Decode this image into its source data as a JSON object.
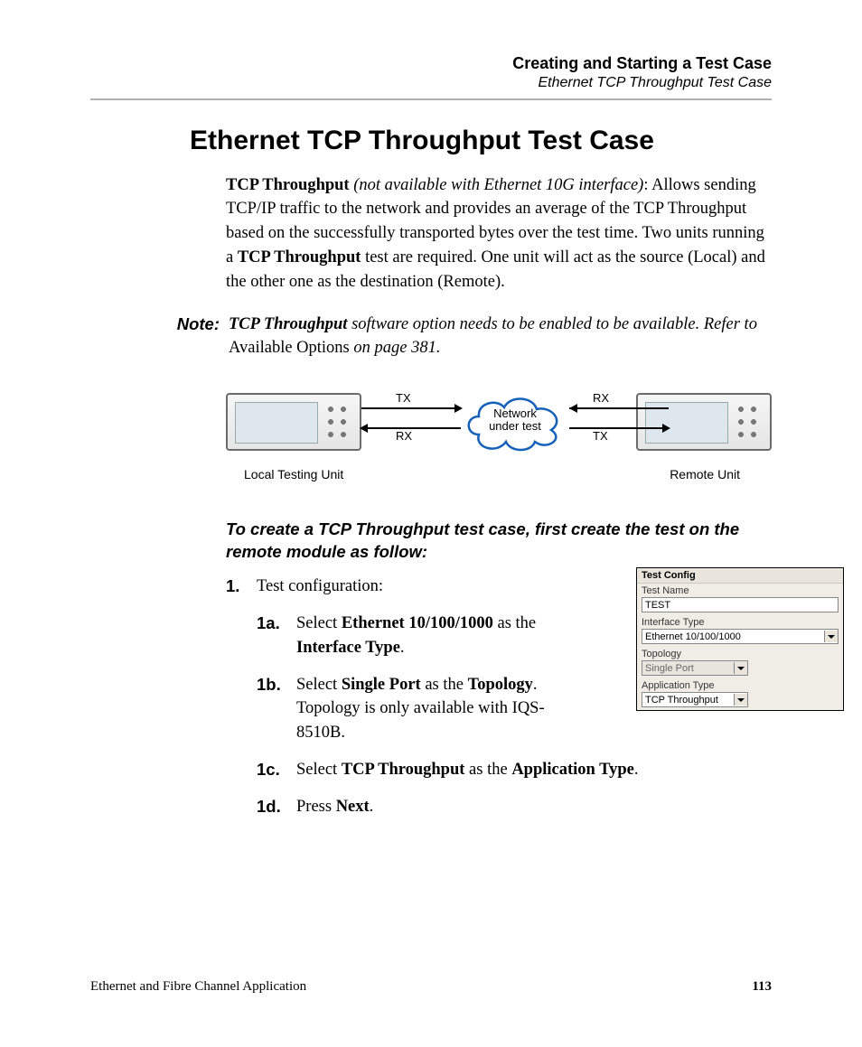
{
  "header": {
    "chapter": "Creating and Starting a Test Case",
    "section": "Ethernet TCP Throughput Test Case"
  },
  "h1": "Ethernet TCP Throughput Test Case",
  "intro": {
    "lead_bold": "TCP Throughput",
    "lead_italic": " (not available with Ethernet 10G interface)",
    "lead_tail": ": Allows sending TCP/IP traffic to the network and provides an average of the TCP Throughput based on the successfully transported bytes over the test time. Two units running a ",
    "mid_bold": "TCP Throughput",
    "tail": " test are required. One unit will act as the source (Local) and the other one as the destination (Remote)."
  },
  "note": {
    "label": "Note:",
    "bold": "TCP Throughput",
    "italic1": " software option needs to be enabled to be available. Refer to ",
    "plain": "Available Options",
    "italic2": " on page 381."
  },
  "diagram": {
    "tx": "TX",
    "rx": "RX",
    "cloud_l1": "Network",
    "cloud_l2": "under test",
    "local": "Local Testing Unit",
    "remote": "Remote Unit"
  },
  "instr_h": "To create a TCP Throughput test case, first create the test on the remote module as follow:",
  "step1": {
    "num": "1.",
    "text": "Test configuration:"
  },
  "sub": {
    "a": {
      "num": "1a.",
      "pre": "Select ",
      "b1": "Ethernet 10/100/1000",
      "mid": " as the ",
      "b2": "Interface Type",
      "post": "."
    },
    "b": {
      "num": "1b.",
      "pre": "Select ",
      "b1": "Single Port",
      "mid": " as the ",
      "b2": "Topology",
      "post": ". Topology is only available with IQS-8510B."
    },
    "c": {
      "num": "1c.",
      "pre": "Select ",
      "b1": "TCP Throughput",
      "mid": " as the ",
      "b2": "Application Type",
      "post": "."
    },
    "d": {
      "num": "1d.",
      "pre": "Press ",
      "b1": "Next",
      "post": "."
    }
  },
  "panel": {
    "title": "Test Config",
    "name_label": "Test Name",
    "name_value": "TEST",
    "iface_label": "Interface Type",
    "iface_value": "Ethernet 10/100/1000",
    "topo_label": "Topology",
    "topo_value": "Single Port",
    "app_label": "Application Type",
    "app_value": "TCP Throughput"
  },
  "footer": {
    "left": "Ethernet and Fibre Channel Application",
    "page": "113"
  }
}
